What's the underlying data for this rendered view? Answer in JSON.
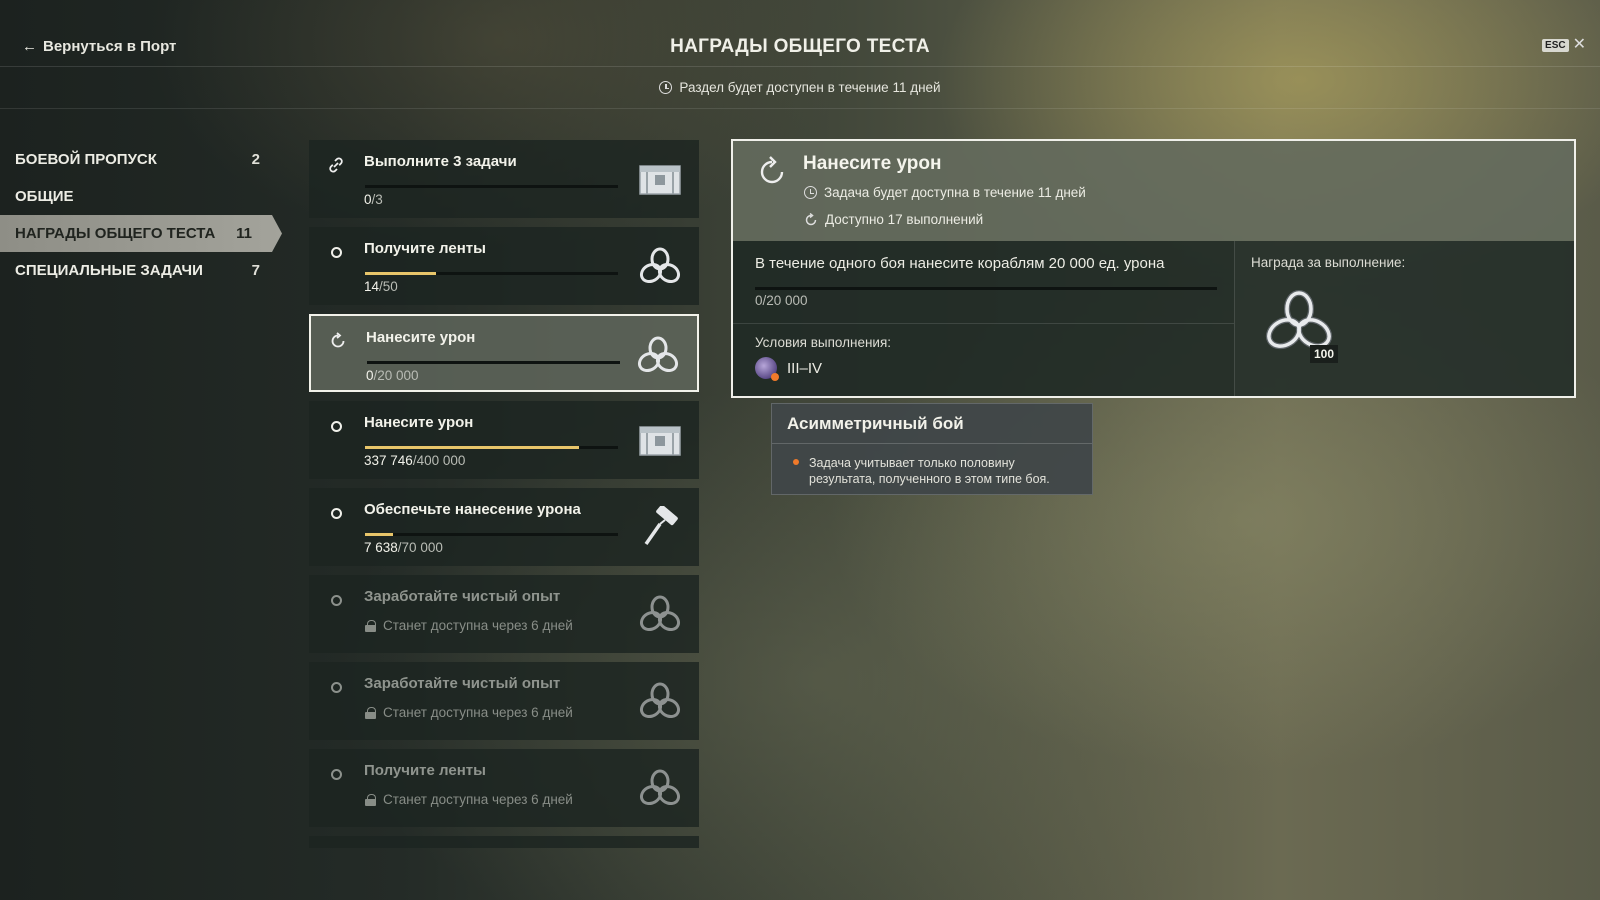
{
  "header": {
    "back_label": "Вернуться в Порт",
    "title": "НАГРАДЫ ОБЩЕГО ТЕСТА",
    "esc_label": "ESC",
    "availability": "Раздел будет доступен в течение 11 дней"
  },
  "sidebar": {
    "items": [
      {
        "label": "БОЕВОЙ ПРОПУСК",
        "count": "2",
        "active": false
      },
      {
        "label": "ОБЩИЕ",
        "count": "",
        "active": false
      },
      {
        "label": "НАГРАДЫ ОБЩЕГО ТЕСТА",
        "count": "11",
        "active": true
      },
      {
        "label": "СПЕЦИАЛЬНЫЕ ЗАДАЧИ",
        "count": "7",
        "active": false
      }
    ]
  },
  "tasks": [
    {
      "icon": "link-icon",
      "title": "Выполните 3 задачи",
      "current": "0",
      "total": "/3",
      "progress": 0,
      "reward": "container-icon",
      "state": "normal"
    },
    {
      "icon": "circle-icon",
      "title": "Получите ленты",
      "current": "14",
      "total": "/50",
      "progress": 0.28,
      "reward": "coal-icon",
      "state": "normal"
    },
    {
      "icon": "repeat-icon",
      "title": "Нанесите урон",
      "current": "0",
      "total": "/20 000",
      "progress": 0,
      "reward": "coal-icon",
      "state": "selected"
    },
    {
      "icon": "circle-icon",
      "title": "Нанесите урон",
      "current": "337 746",
      "total": "/400 000",
      "progress": 0.844,
      "reward": "container-icon",
      "state": "normal"
    },
    {
      "icon": "circle-icon",
      "title": "Обеспечьте нанесение урона",
      "current": "7 638",
      "total": "/70 000",
      "progress": 0.109,
      "reward": "paint-roller-icon",
      "state": "normal"
    },
    {
      "icon": "circle-icon",
      "title": "Заработайте чистый опыт",
      "lock_text": "Станет доступна через 6 дней",
      "reward": "coal-icon",
      "state": "locked"
    },
    {
      "icon": "circle-icon",
      "title": "Заработайте чистый опыт",
      "lock_text": "Станет доступна через 6 дней",
      "reward": "coal-icon",
      "state": "locked"
    },
    {
      "icon": "circle-icon",
      "title": "Получите ленты",
      "lock_text": "Станет доступна через 6 дней",
      "reward": "coal-icon",
      "state": "locked"
    }
  ],
  "detail": {
    "title": "Нанесите урон",
    "availability": "Задача будет доступна в течение 11 дней",
    "completions": "Доступно 17 выполнений",
    "description": "В течение одного боя нанесите кораблям 20 000 ед. урона",
    "progress_text": "0/20 000",
    "progress": 0,
    "conditions_label": "Условия выполнения:",
    "condition_tiers": "III–IV",
    "reward_label": "Награда за выполнение:",
    "reward_amount": "100"
  },
  "tooltip": {
    "title": "Асимметричный бой",
    "text": "Задача учитывает только половину результата, полученного в этом типе боя."
  },
  "colors": {
    "accent_progress": "#e8c56a",
    "condition_dot": "#f07a2a"
  }
}
